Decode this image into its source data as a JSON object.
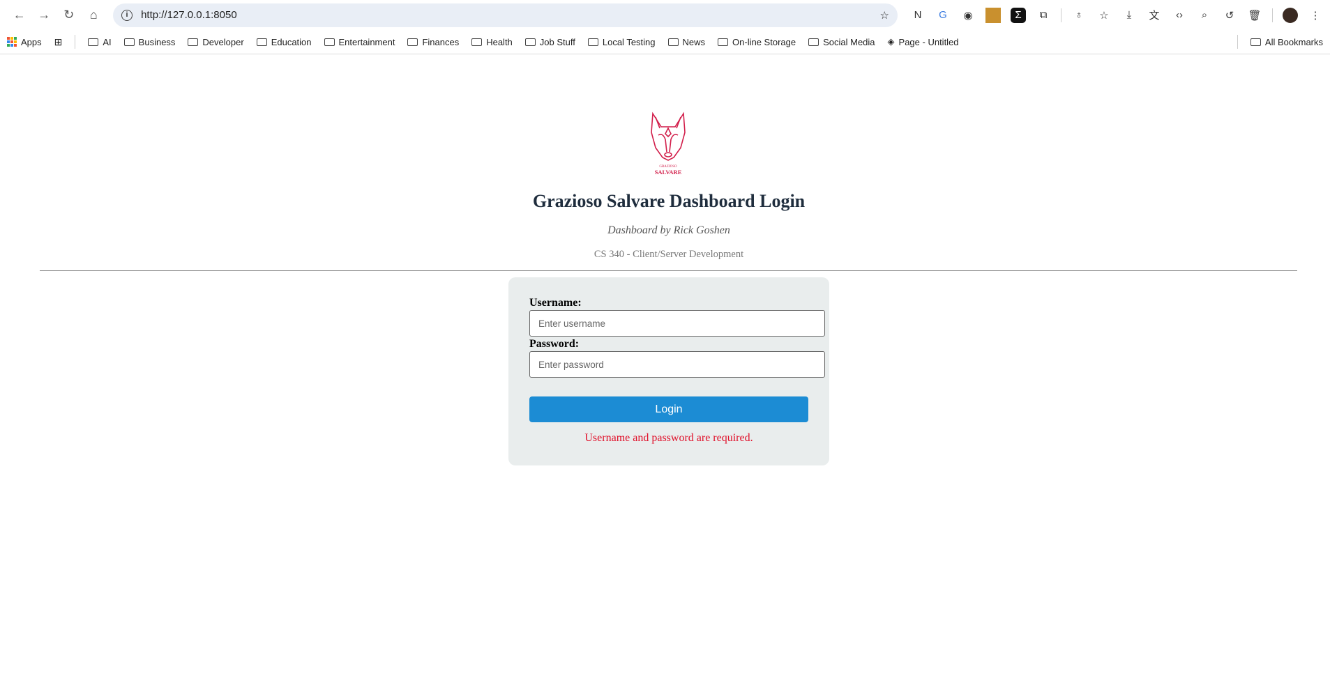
{
  "browser": {
    "url": "http://127.0.0.1:8050",
    "bookmarks": [
      "AI",
      "Business",
      "Developer",
      "Education",
      "Entertainment",
      "Finances",
      "Health",
      "Job Stuff",
      "Local Testing",
      "News",
      "On-line Storage",
      "Social Media"
    ],
    "apps_label": "Apps",
    "page_bookmark": "Page - Untitled",
    "all_bookmarks": "All Bookmarks"
  },
  "logo": {
    "line1": "GRAZIOSO",
    "line2": "SALVARE"
  },
  "header": {
    "title": "Grazioso Salvare Dashboard Login",
    "subtitle": "Dashboard by Rick Goshen",
    "course": "CS 340 - Client/Server Development"
  },
  "form": {
    "username_label": "Username:",
    "username_placeholder": "Enter username",
    "username_value": "",
    "password_label": "Password:",
    "password_placeholder": "Enter password",
    "password_value": "",
    "login_label": "Login",
    "error": "Username and password are required."
  },
  "colors": {
    "accent": "#1c8cd4",
    "error": "#e0102a",
    "brand": "#d21f4b"
  }
}
